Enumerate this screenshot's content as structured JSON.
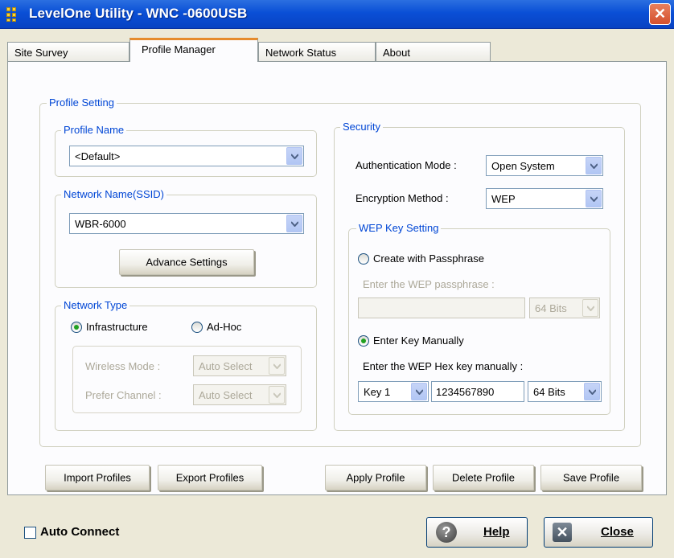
{
  "window": {
    "title": "LevelOne Utility - WNC -0600USB",
    "close_glyph": "✕"
  },
  "tabs": [
    {
      "label": "Site Survey"
    },
    {
      "label": "Profile Manager"
    },
    {
      "label": "Network Status"
    },
    {
      "label": "About"
    }
  ],
  "profile_setting": {
    "title": "Profile Setting",
    "profile_name": {
      "title": "Profile Name",
      "value": "<Default>"
    },
    "network_name": {
      "title": "Network Name(SSID)",
      "value": "WBR-6000",
      "advance_button": "Advance Settings"
    },
    "network_type": {
      "title": "Network Type",
      "infrastructure": "Infrastructure",
      "adhoc": "Ad-Hoc",
      "selected": "Infrastructure",
      "wireless_mode_label": "Wireless Mode :",
      "wireless_mode_value": "Auto Select",
      "prefer_channel_label": "Prefer Channel :",
      "prefer_channel_value": "Auto Select"
    },
    "security": {
      "title": "Security",
      "auth_label": "Authentication Mode :",
      "auth_value": "Open System",
      "enc_label": "Encryption Method :",
      "enc_value": "WEP",
      "wep": {
        "title": "WEP Key Setting",
        "passphrase_option": "Create with Passphrase",
        "passphrase_prompt": "Enter the WEP passphrase :",
        "passphrase_value": "",
        "passphrase_bits": "64 Bits",
        "manual_option": "Enter Key Manually",
        "manual_prompt": "Enter the WEP Hex key manually :",
        "key_index": "Key 1",
        "key_value": "1234567890",
        "key_bits": "64 Bits",
        "selected": "Enter Key Manually"
      }
    }
  },
  "actions": {
    "import": "Import Profiles",
    "export": "Export Profiles",
    "apply": "Apply Profile",
    "delete": "Delete Profile",
    "save": "Save Profile"
  },
  "footer": {
    "auto_connect": "Auto Connect",
    "auto_connect_checked": false,
    "help": "Help",
    "close": "Close"
  }
}
